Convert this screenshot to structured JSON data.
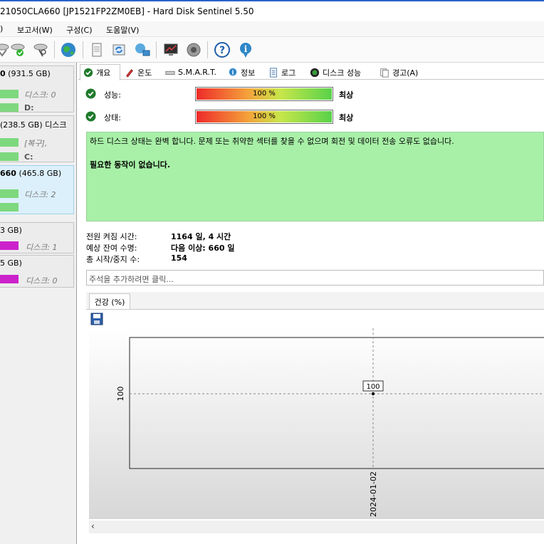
{
  "window": {
    "title": "21050CLA660 [JP1521FP2ZM0EB]  -  Hard Disk Sentinel 5.50"
  },
  "menu": {
    "items": [
      ")",
      "보고서(W)",
      "구성(C)",
      "도움말(V)"
    ]
  },
  "toolbar": {
    "icons": [
      "disk-tool-1-icon",
      "disk-tool-2-icon",
      "disk-tool-3-icon",
      "globe-icon",
      "document-icon",
      "refresh-icon",
      "network-icon",
      "monitor-icon",
      "speaker-icon",
      "help-icon",
      "info-icon"
    ]
  },
  "disks": [
    {
      "name_bold": "0",
      "name_rest": " (931.5 GB)",
      "label": "디스크: 0",
      "drive": "D:",
      "bar_color": "#7ed87e"
    },
    {
      "name_bold": "",
      "name_rest": "(238.5 GB)  디스크",
      "label": "[복구],",
      "drive": "C:",
      "bar_color": "#7ed87e"
    },
    {
      "name_bold": "660",
      "name_rest": " (465.8 GB)",
      "label": "디스크: 2",
      "drive": "",
      "bar_color": "#7ed87e"
    },
    {
      "name_bold": "",
      "name_rest": "3 GB)",
      "label": "디스크: 1",
      "drive": "",
      "bar_color": "#cc22cc"
    },
    {
      "name_bold": "",
      "name_rest": "5 GB)",
      "label": "디스크: 0",
      "drive": "",
      "bar_color": "#cc22cc"
    }
  ],
  "tabs": [
    {
      "label": "개요",
      "icon": "check-icon"
    },
    {
      "label": "온도",
      "icon": "thermometer-icon"
    },
    {
      "label": "S.M.A.R.T.",
      "icon": "smart-icon"
    },
    {
      "label": "정보",
      "icon": "info-icon"
    },
    {
      "label": "로그",
      "icon": "log-icon"
    },
    {
      "label": "디스크 성능",
      "icon": "performance-icon"
    },
    {
      "label": "경고(A)",
      "icon": "alert-icon"
    }
  ],
  "overview": {
    "performance": {
      "label": "성능:",
      "value_text": "100 %",
      "value": 100,
      "rating": "최상"
    },
    "health": {
      "label": "상태:",
      "value_text": "100 %",
      "value": 100,
      "rating": "최상"
    },
    "message_line": "하드 디스크 상태는 완벽 합니다. 문제 또는 취약한 섹터를 찾을 수 없으며 회전 및 데이터 전송 오류도 없습니다.",
    "message_action": "필요한 동작이 없습니다.",
    "power_on_label": "전원 켜짐 시간:",
    "power_on_value": "1164 일, 4 시간",
    "lifetime_label": "예상 잔여 수명:",
    "lifetime_value": "다음 이상: 660 일",
    "startstop_label": "총 시작/중지 수:",
    "startstop_value": "154",
    "note_placeholder": "주석을 추가하려면 클릭..."
  },
  "graph": {
    "tab_label": "건강 (%)"
  },
  "chart_data": {
    "type": "line",
    "x": [
      "2024-01-02"
    ],
    "series": [
      {
        "values": [
          100
        ]
      }
    ],
    "ytick": "100",
    "data_label": "100",
    "grid": true
  },
  "colors": {
    "message_bg": "#a8f0a8",
    "accent": "#2a63c9"
  }
}
